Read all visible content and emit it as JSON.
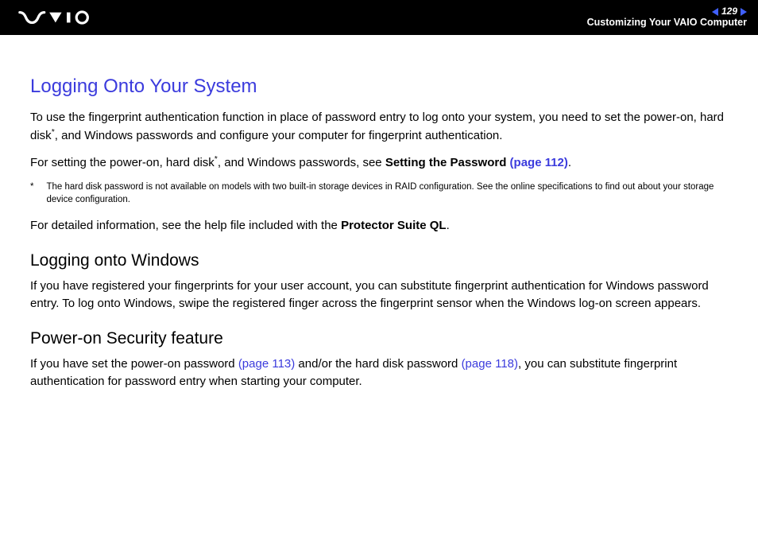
{
  "header": {
    "page_number": "129",
    "breadcrumb": "Customizing Your VAIO Computer"
  },
  "title": "Logging Onto Your System",
  "para1a": "To use the fingerprint authentication function in place of password entry to log onto your system, you need to set the power-on, hard disk",
  "para1b": ", and Windows passwords and configure your computer for fingerprint authentication.",
  "para2a": "For setting the power-on, hard disk",
  "para2b": ", and Windows passwords, see ",
  "para2_bold": "Setting the Password ",
  "para2_link": "(page 112)",
  "para2_end": ".",
  "footnote_marker": "*",
  "footnote_text": "The hard disk password is not available on models with two built-in storage devices in RAID configuration. See the online specifications to find out about your storage device configuration.",
  "para3a": "For detailed information, see the help file included with the ",
  "para3_bold": "Protector Suite QL",
  "para3_end": ".",
  "sub1": "Logging onto Windows",
  "sub1_para": "If you have registered your fingerprints for your user account, you can substitute fingerprint authentication for Windows password entry. To log onto Windows, swipe the registered finger across the fingerprint sensor when the Windows log-on screen appears.",
  "sub2": "Power-on Security feature",
  "sub2_para_a": "If you have set the power-on password ",
  "sub2_link1": "(page 113)",
  "sub2_para_b": " and/or the hard disk password ",
  "sub2_link2": "(page 118)",
  "sub2_para_c": ", you can substitute fingerprint authentication for password entry when starting your computer."
}
